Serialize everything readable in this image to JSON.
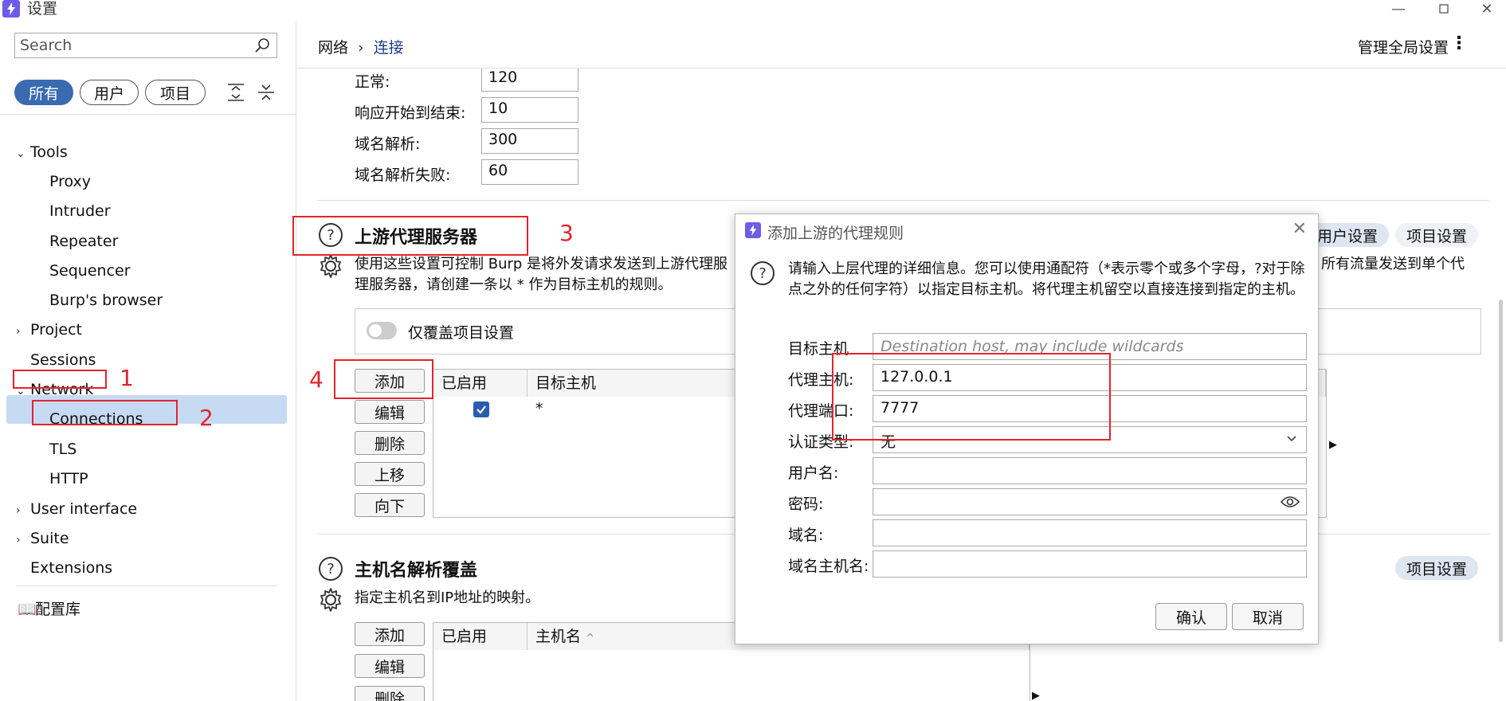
{
  "window": {
    "title": "设置"
  },
  "sidebar": {
    "search_placeholder": "Search",
    "filters": [
      "所有",
      "用户",
      "项目"
    ],
    "tree": [
      {
        "label": "Tools",
        "expanded": true
      },
      {
        "label": "Proxy"
      },
      {
        "label": "Intruder"
      },
      {
        "label": "Repeater"
      },
      {
        "label": "Sequencer"
      },
      {
        "label": "Burp's browser"
      },
      {
        "label": "Project",
        "expanded": false
      },
      {
        "label": "Sessions"
      },
      {
        "label": "Network",
        "expanded": true
      },
      {
        "label": "Connections",
        "selected": true
      },
      {
        "label": "TLS"
      },
      {
        "label": "HTTP"
      },
      {
        "label": "User interface",
        "expanded": false
      },
      {
        "label": "Suite",
        "expanded": false
      },
      {
        "label": "Extensions"
      }
    ],
    "config_library": "配置库"
  },
  "header": {
    "breadcrumb_parent": "网络",
    "breadcrumb_current": "连接",
    "global_settings": "管理全局设置"
  },
  "timeouts": {
    "rows": [
      {
        "label": "正常:",
        "value": "120"
      },
      {
        "label": "响应开始到结束:",
        "value": "10"
      },
      {
        "label": "域名解析:",
        "value": "300"
      },
      {
        "label": "域名解析失败:",
        "value": "60"
      }
    ]
  },
  "upstream": {
    "title": "上游代理服务器",
    "desc_line1": "使用这些设置可控制 Burp 是将外发请求发送到上游代理服",
    "desc_line1_tail": "所有流量发送到单个代",
    "desc_line2": "理服务器，请创建一条以 * 作为目标主机的规则。",
    "override_label": "仅覆盖项目设置",
    "buttons": [
      "添加",
      "编辑",
      "删除",
      "上移",
      "向下"
    ],
    "columns": [
      "已启用",
      "目标主机"
    ],
    "row_host": "*",
    "pill_user": "用户设置",
    "pill_project": "项目设置"
  },
  "hostname": {
    "title": "主机名解析覆盖",
    "desc": "指定主机名到IP地址的映射。",
    "buttons": [
      "添加",
      "编辑",
      "删除"
    ],
    "columns": [
      "已启用",
      "主机名"
    ],
    "pill_project": "项目设置"
  },
  "annotations": [
    "1",
    "2",
    "3",
    "4"
  ],
  "dialog": {
    "title": "添加上游的代理规则",
    "info": "请输入上层代理的详细信息。您可以使用通配符（*表示零个或多个字母，?对于除点之外的任何字符）以指定目标主机。将代理主机留空以直接连接到指定的主机。",
    "fields": {
      "target_host": {
        "label": "目标主机",
        "placeholder": "Destination host, may include wildcards",
        "value": ""
      },
      "proxy_host": {
        "label": "代理主机:",
        "value": "127.0.0.1"
      },
      "proxy_port": {
        "label": "代理端口:",
        "value": "7777"
      },
      "auth_type": {
        "label": "认证类型:",
        "value": "无"
      },
      "username": {
        "label": "用户名:",
        "value": ""
      },
      "password": {
        "label": "密码:",
        "value": ""
      },
      "domain": {
        "label": "域名:",
        "value": ""
      },
      "domain_host": {
        "label": "域名主机名:",
        "value": ""
      }
    },
    "ok": "确认",
    "cancel": "取消"
  }
}
